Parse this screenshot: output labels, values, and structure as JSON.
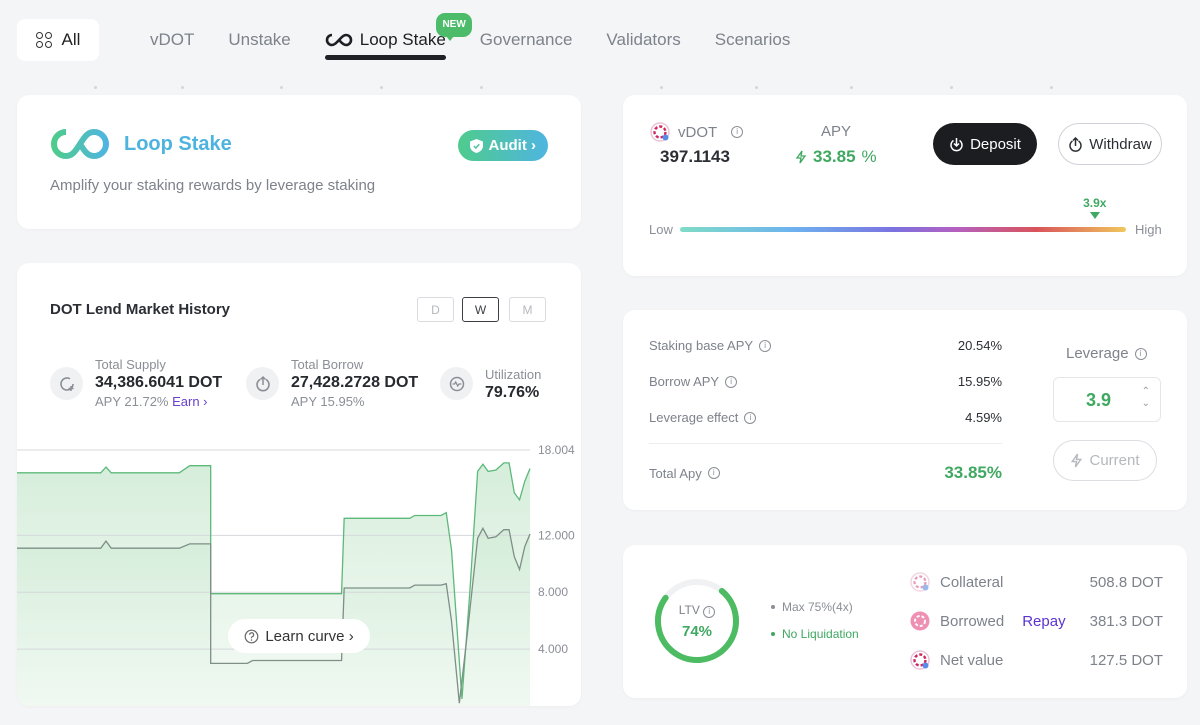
{
  "nav": {
    "all_label": "All",
    "tabs": [
      {
        "label": "vDOT",
        "active": false
      },
      {
        "label": "Unstake",
        "active": false
      },
      {
        "label": "Loop Stake",
        "active": true,
        "badge": "NEW"
      },
      {
        "label": "Governance",
        "active": false
      },
      {
        "label": "Validators",
        "active": false
      },
      {
        "label": "Scenarios",
        "active": false
      }
    ]
  },
  "hero": {
    "title": "Loop Stake",
    "subtitle": "Amplify your staking rewards by leverage staking",
    "audit_label": "Audit ›"
  },
  "market": {
    "title": "DOT Lend Market History",
    "periods": [
      {
        "label": "D"
      },
      {
        "label": "W",
        "active": true
      },
      {
        "label": "M"
      }
    ],
    "total_supply": {
      "label": "Total Supply",
      "value": "34,386.6041 DOT",
      "apy": "APY 21.72%",
      "earn": "Earn ›"
    },
    "total_borrow": {
      "label": "Total Borrow",
      "value": "27,428.2728 DOT",
      "apy": "APY 15.95%"
    },
    "utilization": {
      "label": "Utilization",
      "value": "79.76%"
    },
    "learn_curve": "Learn curve ›"
  },
  "chart_data": {
    "type": "area",
    "title": "DOT Lend Market History",
    "y_ticks": [
      "18.004",
      "12.000",
      "8.000",
      "4.000"
    ],
    "ylim": [
      0,
      18.004
    ],
    "grid": true,
    "series": [
      {
        "name": "Total Supply",
        "color": "#5cb97a",
        "points": [
          [
            0,
            16.4
          ],
          [
            0.32,
            16.4
          ],
          [
            0.34,
            16.8
          ],
          [
            0.36,
            16.4
          ],
          [
            0.62,
            16.4
          ],
          [
            0.66,
            16.9
          ],
          [
            0.74,
            16.9
          ],
          [
            0.74,
            7.9
          ],
          [
            0.88,
            7.9
          ],
          [
            1.0,
            7.9
          ],
          [
            1.24,
            7.9
          ],
          [
            1.25,
            13.2
          ],
          [
            1.5,
            13.2
          ],
          [
            1.52,
            13.4
          ],
          [
            1.62,
            13.4
          ],
          [
            1.64,
            13.6
          ],
          [
            1.66,
            11
          ],
          [
            1.7,
            0.5
          ],
          [
            1.73,
            8
          ],
          [
            1.76,
            16.5
          ],
          [
            1.78,
            17.0
          ],
          [
            1.8,
            16.5
          ],
          [
            1.83,
            16.6
          ],
          [
            1.86,
            17.1
          ],
          [
            1.88,
            17.1
          ],
          [
            1.9,
            15
          ],
          [
            1.92,
            14.5
          ],
          [
            1.94,
            15.8
          ],
          [
            1.96,
            16.7
          ]
        ]
      },
      {
        "name": "Total Borrow",
        "color": "#7d8f86",
        "points": [
          [
            0,
            11.1
          ],
          [
            0.32,
            11.1
          ],
          [
            0.34,
            11.6
          ],
          [
            0.36,
            11.1
          ],
          [
            0.62,
            11.1
          ],
          [
            0.66,
            11.4
          ],
          [
            0.74,
            11.4
          ],
          [
            0.74,
            3.0
          ],
          [
            0.88,
            3.0
          ],
          [
            0.9,
            3.2
          ],
          [
            1.24,
            3.2
          ],
          [
            1.25,
            8.3
          ],
          [
            1.5,
            8.3
          ],
          [
            1.52,
            8.5
          ],
          [
            1.62,
            8.5
          ],
          [
            1.64,
            8.6
          ],
          [
            1.66,
            6
          ],
          [
            1.69,
            0.2
          ],
          [
            1.72,
            5
          ],
          [
            1.76,
            11.8
          ],
          [
            1.78,
            12.5
          ],
          [
            1.8,
            11.8
          ],
          [
            1.83,
            11.9
          ],
          [
            1.86,
            12.4
          ],
          [
            1.88,
            12.4
          ],
          [
            1.9,
            10.5
          ],
          [
            1.92,
            9.6
          ],
          [
            1.94,
            11.2
          ],
          [
            1.96,
            12.1
          ]
        ]
      }
    ]
  },
  "vdot": {
    "token": "vDOT",
    "amount": "397.1143",
    "apy_label": "APY",
    "apy_value": "33.85",
    "apy_unit": "%",
    "deposit_label": "Deposit",
    "withdraw_label": "Withdraw",
    "low_label": "Low",
    "high_label": "High",
    "leverage_marker": "3.9x",
    "leverage_fraction": 0.93
  },
  "apy": {
    "rows": [
      {
        "label": "Staking base APY",
        "value": "20.54%"
      },
      {
        "label": "Borrow APY",
        "value": "15.95%"
      },
      {
        "label": "Leverage effect",
        "value": "4.59%"
      }
    ],
    "total_label": "Total Apy",
    "total_value": "33.85%",
    "leverage_label": "Leverage",
    "leverage_value": "3.9",
    "current_label": "Current"
  },
  "ltv": {
    "label": "LTV",
    "value": "74%",
    "fraction": 0.74,
    "max_note": "Max 75%(4x)",
    "status_note": "No Liquidation",
    "positions": [
      {
        "label": "Collateral",
        "value": "508.8 DOT"
      },
      {
        "label": "Borrowed",
        "value": "381.3 DOT",
        "action": "Repay"
      },
      {
        "label": "Net value",
        "value": "127.5 DOT"
      }
    ]
  },
  "colors": {
    "accent_green": "#3fa861",
    "brand_teal": "#4db3df",
    "link_purple": "#5a34d0"
  }
}
